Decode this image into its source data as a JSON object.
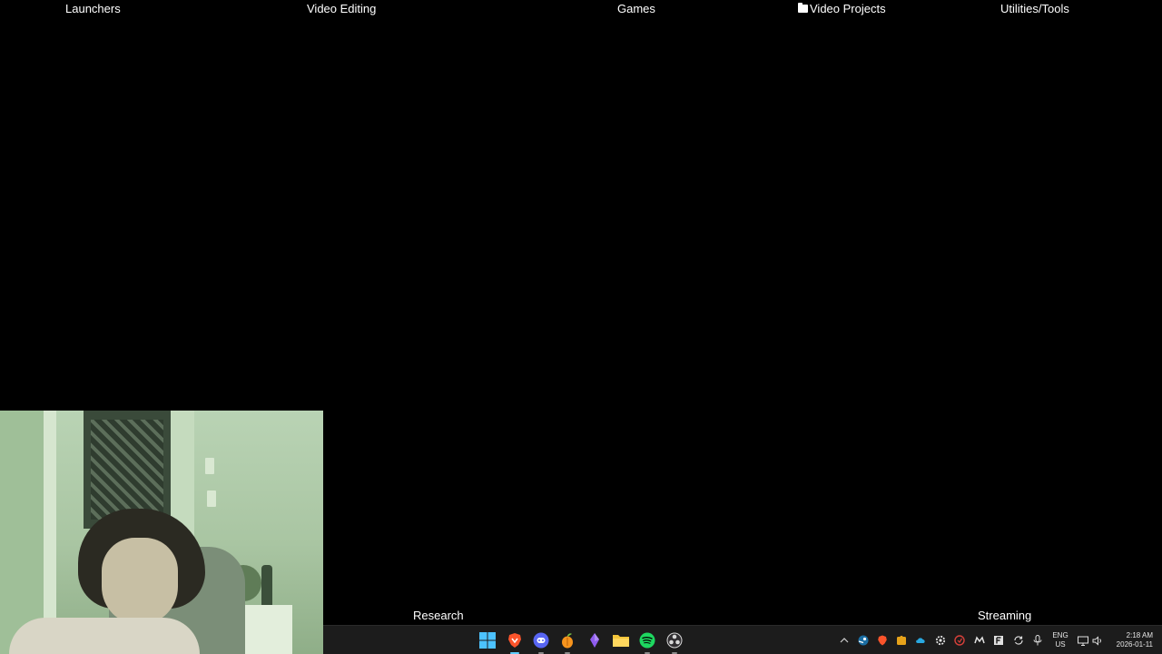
{
  "desktop": {
    "group_labels": {
      "launchers": "Launchers",
      "video_editing": "Video Editing",
      "games": "Games",
      "video_projects": "Video Projects",
      "utilities_tools": "Utilities/Tools",
      "research": "Research",
      "streaming": "Streaming"
    }
  },
  "taskbar": {
    "pinned_apps": [
      {
        "name": "start-menu",
        "icon": "windows-logo-icon"
      },
      {
        "name": "brave",
        "icon": "brave-lion-icon",
        "active": true
      },
      {
        "name": "discord",
        "icon": "discord-icon"
      },
      {
        "name": "fl-studio",
        "icon": "fl-studio-fruit-icon"
      },
      {
        "name": "crystal-app",
        "icon": "purple-crystal-icon"
      },
      {
        "name": "file-explorer",
        "icon": "folder-icon"
      },
      {
        "name": "spotify",
        "icon": "spotify-icon"
      },
      {
        "name": "obs",
        "icon": "obs-icon"
      }
    ],
    "tray": {
      "language_primary": "ENG",
      "language_secondary": "US",
      "time": "2:18 AM",
      "date": "2026-01-11"
    }
  },
  "colors": {
    "desktop_bg": "#000000",
    "taskbar_bg": "#1c1c1c",
    "label_text": "#ffffff",
    "active_indicator": "#60cdff"
  }
}
